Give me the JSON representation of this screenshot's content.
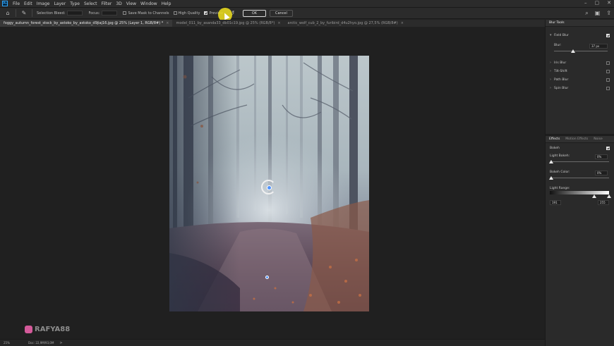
{
  "menu": {
    "logo": "Ps",
    "items": [
      "File",
      "Edit",
      "Image",
      "Layer",
      "Type",
      "Select",
      "Filter",
      "3D",
      "View",
      "Window",
      "Help"
    ],
    "window_controls": [
      "–",
      "▢",
      "✕"
    ]
  },
  "options_bar": {
    "selection_bleed_label": "Selection Bleed:",
    "focus_label": "Focus:",
    "save_mask_label": "Save Mask to Channels",
    "high_quality_label": "High Quality",
    "preview_label": "Preview",
    "ok_label": "OK",
    "cancel_label": "Cancel",
    "preview_checked": true,
    "save_mask_checked": false,
    "high_quality_checked": false
  },
  "tabs": [
    {
      "label": "foggy_autumn_forest_stock_by_astoko_by_astoko_d9jiaj16.jpg @ 25% (Layer 1, RGB/8#) *",
      "active": true
    },
    {
      "label": "model_011_by_asanda33_db01c19.jpg @ 25% (RGB/8*)",
      "active": false
    },
    {
      "label": "arctic_wolf_cub_2_by_furibird_d4u2hyo.jpg @ 27,5% (RGB/8#)",
      "active": false
    }
  ],
  "status_bar": {
    "zoom": "25%",
    "doc": "Doc: 22,9M/93,0M",
    "arrow": ">"
  },
  "watermark": "RAFYA88",
  "blur_tools": {
    "title": "Blur Tools",
    "field_blur_label": "Field Blur",
    "field_blur_checked": true,
    "blur_label": "Blur:",
    "blur_value": "37 px",
    "blur_amount_fraction": 0.36,
    "others": [
      {
        "label": "Iris Blur"
      },
      {
        "label": "Tilt-Shift"
      },
      {
        "label": "Path Blur"
      },
      {
        "label": "Spin Blur"
      }
    ]
  },
  "effects": {
    "tabs": [
      "Effects",
      "Motion Effects",
      "Noise"
    ],
    "bokeh_label": "Bokeh",
    "bokeh_checked": true,
    "light_bokeh_label": "Light Bokeh:",
    "light_bokeh_value": "0%",
    "bokeh_color_label": "Bokeh Color:",
    "bokeh_color_value": "0%",
    "light_range_label": "Light Range:",
    "range_low": "191",
    "range_high": "255"
  }
}
